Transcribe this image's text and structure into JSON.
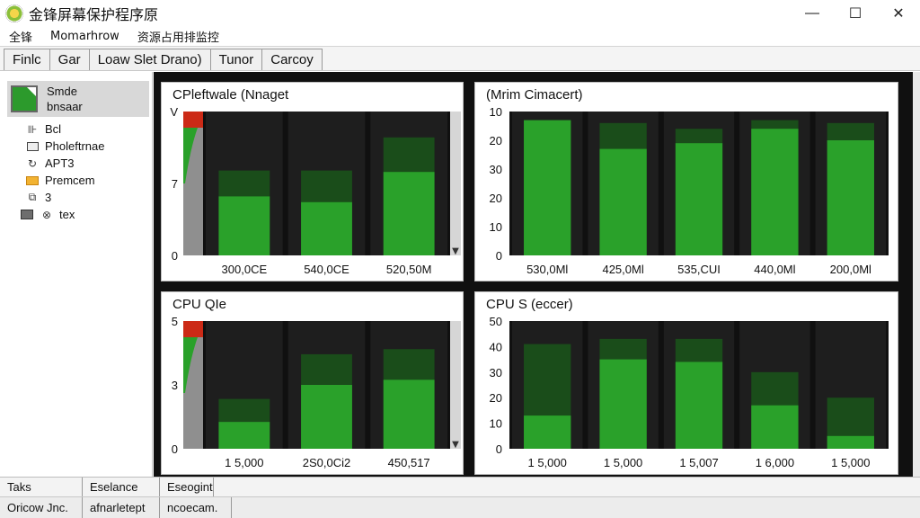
{
  "window": {
    "title": "金锋屏幕保护程序原",
    "controls": {
      "minimize": "—",
      "maximize": "☐",
      "close": "✕"
    }
  },
  "menu": [
    "全锋",
    "Momarhrow",
    "资源占用排监控"
  ],
  "toolbar": [
    "Finlc",
    "Gar",
    "Loaw Slet Drano)",
    "Tunor",
    "Carcoy"
  ],
  "sidebar": {
    "selected": {
      "line1": "Smde",
      "line2": "bnsaar"
    },
    "items": [
      {
        "icon": "chart-icon",
        "glyph": "⊪",
        "label": "Bcl"
      },
      {
        "icon": "window-icon",
        "glyph": "",
        "label": "Pholeftrnae"
      },
      {
        "icon": "refresh-icon",
        "glyph": "↻",
        "label": "APT3"
      },
      {
        "icon": "folder-icon",
        "glyph": "",
        "label": "Premcem"
      },
      {
        "icon": "layers-icon",
        "glyph": "⧉",
        "label": "3"
      },
      {
        "icon": "disk-icon",
        "glyph": "⊗",
        "label": "tex"
      }
    ]
  },
  "colors": {
    "bar_fill": "#2aa12a",
    "bar_shadow": "#1a4d1a",
    "plot_bg": "#101010",
    "column_bg": "#1e1e1e",
    "accent_red": "#cc2a16"
  },
  "chart_data": [
    {
      "type": "bar",
      "title": "CPleftwale (Nnaget",
      "categories": [
        "300,0CE",
        "540,0CE",
        "520,50M"
      ],
      "yticks": [
        "0",
        "7",
        "V"
      ],
      "ylim": [
        0,
        10
      ],
      "values": [
        4.1,
        3.7,
        5.8
      ],
      "shadow": [
        5.9,
        5.9,
        8.2
      ],
      "left_strip": true,
      "scrollbar": true
    },
    {
      "type": "bar",
      "title": "(Mrim Cimacert)",
      "categories": [
        "530,0Ml",
        "425,0Ml",
        "535,CUI",
        "440,0Ml",
        "200,0Ml"
      ],
      "yticks": [
        "0",
        "10",
        "20",
        "30",
        "20",
        "10"
      ],
      "ylim": [
        0,
        50
      ],
      "values": [
        47,
        37,
        39,
        44,
        40
      ],
      "shadow": [
        47,
        46,
        44,
        47,
        46
      ],
      "left_strip": false,
      "scrollbar": false
    },
    {
      "type": "bar",
      "title": "CPU QIe",
      "categories": [
        "1 5,000",
        "2S0,0Ci2",
        "450,517"
      ],
      "yticks": [
        "0",
        "3",
        "5"
      ],
      "ylim": [
        0,
        10
      ],
      "values": [
        2.1,
        5.0,
        5.4
      ],
      "shadow": [
        3.9,
        7.4,
        7.8
      ],
      "left_strip": true,
      "scrollbar": true
    },
    {
      "type": "bar",
      "title": "CPU S (eccer)",
      "categories": [
        "1 5,000",
        "1 5,000",
        "1 5,007",
        "1 6,000",
        "1 5,000"
      ],
      "yticks": [
        "0",
        "10",
        "20",
        "30",
        "40",
        "50"
      ],
      "ylim": [
        0,
        50
      ],
      "values": [
        13,
        35,
        34,
        17,
        5
      ],
      "shadow": [
        41,
        43,
        43,
        30,
        20
      ],
      "left_strip": false,
      "scrollbar": false
    }
  ],
  "status_bar": {
    "row1": [
      "Taks",
      "Eselance",
      "Eseogint"
    ],
    "row2": [
      "Oricow Jnc.",
      "afnarletept",
      "ncoecam."
    ]
  }
}
